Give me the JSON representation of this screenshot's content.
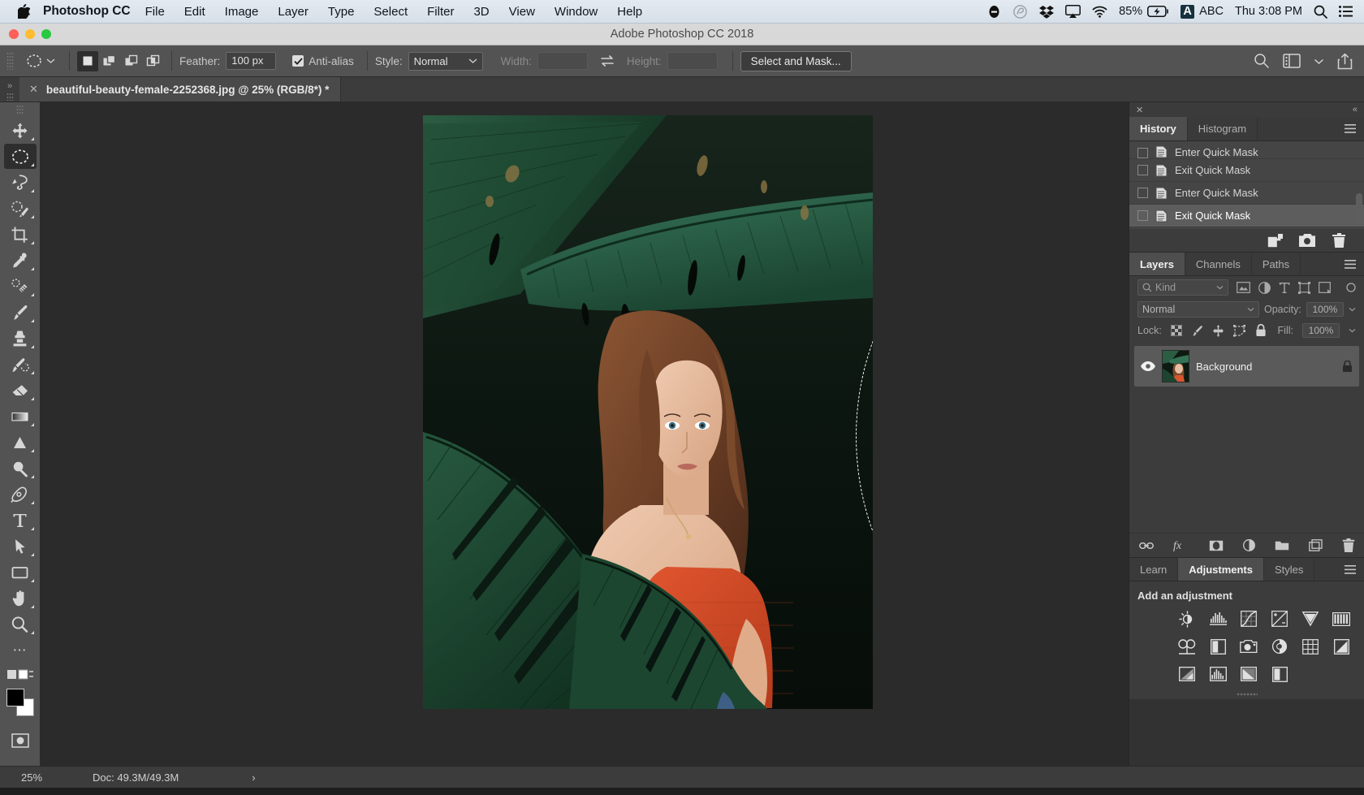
{
  "macos_menubar": {
    "apple_icon": "apple-icon",
    "app_name": "Photoshop CC",
    "menus": [
      "File",
      "Edit",
      "Image",
      "Layer",
      "Type",
      "Select",
      "Filter",
      "3D",
      "View",
      "Window",
      "Help"
    ],
    "status_items": {
      "do_not_disturb_icon": "minus-circle-icon",
      "creative_cloud_icon": "creative-cloud-icon",
      "dropbox_icon": "dropbox-icon",
      "airplay_icon": "airplay-icon",
      "wifi_icon": "wifi-icon",
      "battery_percent": "85%",
      "battery_icon": "battery-charging-icon",
      "input_source_badge": "A",
      "input_source": "ABC",
      "clock": "Thu 3:08 PM",
      "spotlight_icon": "search-icon",
      "control_center_icon": "list-icon"
    }
  },
  "window": {
    "title": "Adobe Photoshop CC 2018",
    "close_color": "#ff5f57",
    "minimize_color": "#febc2e",
    "zoom_color": "#28c840"
  },
  "options_bar": {
    "tool_preset_icon": "elliptical-marquee-icon",
    "tool_preset_caret": "chevron-down-icon",
    "selection_modes": [
      {
        "name": "new-selection",
        "active": true
      },
      {
        "name": "add-to-selection",
        "active": false
      },
      {
        "name": "subtract-from-selection",
        "active": false
      },
      {
        "name": "intersect-with-selection",
        "active": false
      }
    ],
    "feather_label": "Feather:",
    "feather_value": "100 px",
    "antialias_label": "Anti-alias",
    "antialias_checked": true,
    "style_label": "Style:",
    "style_value": "Normal",
    "width_label": "Width:",
    "width_value": "",
    "swap_icon": "swap-arrows-icon",
    "height_label": "Height:",
    "height_value": "",
    "select_and_mask_label": "Select and Mask...",
    "right_icons": [
      "search-icon",
      "workspace-icon",
      "chevron-down-icon",
      "share-icon"
    ]
  },
  "tab_bar": {
    "dock_expand_icon": "chevron-double-right-icon",
    "tabs": [
      {
        "close_icon": "close-icon",
        "label": "beautiful-beauty-female-2252368.jpg @ 25% (RGB/8*) *",
        "active": true
      }
    ]
  },
  "toolbar": {
    "tools": [
      {
        "name": "move-tool",
        "glyph": "move",
        "active": false
      },
      {
        "name": "elliptical-marquee-tool",
        "glyph": "ellipse-marquee",
        "active": true
      },
      {
        "name": "lasso-tool",
        "glyph": "lasso",
        "active": false
      },
      {
        "name": "object-selection-tool",
        "glyph": "quick-select",
        "active": false
      },
      {
        "name": "crop-tool",
        "glyph": "crop",
        "active": false
      },
      {
        "name": "eyedropper-tool",
        "glyph": "eyedropper",
        "active": false
      },
      {
        "name": "spot-healing-brush-tool",
        "glyph": "healing",
        "active": false
      },
      {
        "name": "brush-tool",
        "glyph": "brush",
        "active": false
      },
      {
        "name": "clone-stamp-tool",
        "glyph": "stamp",
        "active": false
      },
      {
        "name": "history-brush-tool",
        "glyph": "history-brush",
        "active": false
      },
      {
        "name": "eraser-tool",
        "glyph": "eraser",
        "active": false
      },
      {
        "name": "gradient-tool",
        "glyph": "gradient",
        "active": false
      },
      {
        "name": "blur-tool",
        "glyph": "dodge",
        "active": false
      },
      {
        "name": "dodge-tool",
        "glyph": "magnify-dodge",
        "active": false
      },
      {
        "name": "pen-tool",
        "glyph": "pen",
        "active": false
      },
      {
        "name": "type-tool",
        "glyph": "type",
        "active": false
      },
      {
        "name": "path-selection-tool",
        "glyph": "arrow",
        "active": false
      },
      {
        "name": "rectangle-tool",
        "glyph": "rectangle",
        "active": false
      },
      {
        "name": "hand-tool",
        "glyph": "hand",
        "active": false
      },
      {
        "name": "zoom-tool",
        "glyph": "zoom",
        "active": false
      }
    ],
    "more_tools_icon": "ellipsis-icon",
    "edit_toolbar_icon": "edit-toolbar-icon",
    "foreground_color": "#000000",
    "background_color": "#ffffff",
    "quick_mask_icon": "quick-mask-icon"
  },
  "history_panel": {
    "close_icon": "close-icon",
    "collapse_icon": "chevron-double-left-icon",
    "menu_icon": "panel-menu-icon",
    "tabs": [
      {
        "label": "History",
        "active": true
      },
      {
        "label": "Histogram",
        "active": false
      }
    ],
    "items": [
      {
        "label": "Enter Quick Mask",
        "selected": false,
        "clipped": true
      },
      {
        "label": "Exit Quick Mask",
        "selected": false
      },
      {
        "label": "Enter Quick Mask",
        "selected": false
      },
      {
        "label": "Exit Quick Mask",
        "selected": true
      }
    ],
    "buttons": [
      {
        "name": "create-document-from-state-icon"
      },
      {
        "name": "create-new-snapshot-icon"
      },
      {
        "name": "delete-state-icon"
      }
    ]
  },
  "layers_panel": {
    "menu_icon": "panel-menu-icon",
    "tabs": [
      {
        "label": "Layers",
        "active": true
      },
      {
        "label": "Channels",
        "active": false
      },
      {
        "label": "Paths",
        "active": false
      }
    ],
    "filter": {
      "search_icon": "search-icon",
      "kind_label": "Kind",
      "caret_icon": "chevron-down-icon",
      "filter_icons": [
        "pixel-layer-icon",
        "adjustment-layer-icon",
        "type-layer-icon",
        "shape-layer-icon",
        "smart-object-icon"
      ],
      "toggle_icon": "filter-toggle-icon"
    },
    "blend_mode": "Normal",
    "opacity_label": "Opacity:",
    "opacity_value": "100%",
    "lock_label": "Lock:",
    "lock_icons": [
      "lock-transparent-pixels-icon",
      "lock-image-pixels-icon",
      "lock-position-icon",
      "lock-artboard-icon",
      "lock-all-icon"
    ],
    "fill_label": "Fill:",
    "fill_value": "100%",
    "layers": [
      {
        "visible": true,
        "eye_icon": "eye-icon",
        "name": "Background",
        "locked": true,
        "lock_icon": "lock-icon",
        "selected": true
      }
    ],
    "bottom_buttons": [
      {
        "name": "link-layers-icon"
      },
      {
        "name": "layer-style-fx-icon"
      },
      {
        "name": "add-layer-mask-icon"
      },
      {
        "name": "new-adjustment-layer-icon"
      },
      {
        "name": "new-group-icon"
      },
      {
        "name": "new-layer-icon"
      },
      {
        "name": "delete-layer-icon"
      }
    ]
  },
  "adjustments_panel": {
    "menu_icon": "panel-menu-icon",
    "tabs": [
      {
        "label": "Learn",
        "active": false
      },
      {
        "label": "Adjustments",
        "active": true
      },
      {
        "label": "Styles",
        "active": false
      }
    ],
    "heading": "Add an adjustment",
    "icons_row1": [
      "brightness-contrast-icon",
      "levels-icon",
      "curves-icon",
      "exposure-icon",
      "vibrance-icon"
    ],
    "icons_row2": [
      "hue-saturation-icon",
      "color-balance-icon",
      "black-and-white-icon",
      "photo-filter-icon",
      "channel-mixer-icon",
      "color-lookup-icon"
    ],
    "icons_row3": [
      "invert-icon",
      "posterize-icon",
      "threshold-icon",
      "gradient-map-icon",
      "selective-color-icon"
    ]
  },
  "status_bar": {
    "zoom": "25%",
    "doc_info": "Doc: 49.3M/49.3M",
    "expand_icon": "chevron-right-icon"
  },
  "canvas": {
    "document_name": "beautiful-beauty-female-2252368.jpg",
    "zoom_level": "25%",
    "selection_shape": "ellipse",
    "selection_active": true
  }
}
